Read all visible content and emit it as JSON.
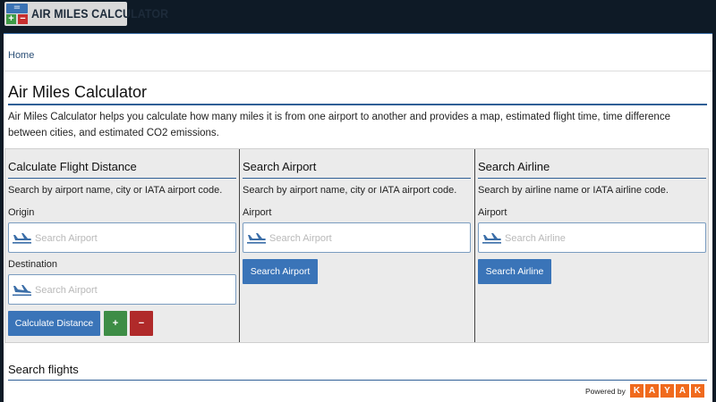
{
  "brand": {
    "logo_text": "AIR MILES CALCULATOR",
    "logo_top_glyph": "=",
    "logo_plus": "+",
    "logo_minus": "−"
  },
  "breadcrumb": {
    "home": "Home"
  },
  "page": {
    "title": "Air Miles Calculator",
    "intro": "Air Miles Calculator helps you calculate how many miles it is from one airport to another and provides a map, estimated flight time, time difference between cities, and estimated CO2 emissions."
  },
  "panels": {
    "distance": {
      "heading": "Calculate Flight Distance",
      "description": "Search by airport name, city or IATA airport code.",
      "origin_label": "Origin",
      "origin_placeholder": "Search Airport",
      "destination_label": "Destination",
      "destination_placeholder": "Search Airport",
      "calculate_button": "Calculate Distance",
      "add_button": "+",
      "remove_button": "−"
    },
    "airport": {
      "heading": "Search Airport",
      "description": "Search by airport name, city or IATA airport code.",
      "field_label": "Airport",
      "placeholder": "Search Airport",
      "button": "Search Airport"
    },
    "airline": {
      "heading": "Search Airline",
      "description": "Search by airline name or IATA airline code.",
      "field_label": "Airport",
      "placeholder": "Search Airline",
      "button": "Search Airline"
    }
  },
  "flights": {
    "heading": "Search flights",
    "powered_by": "Powered by",
    "kayak_letters": [
      "K",
      "A",
      "Y",
      "A",
      "K"
    ]
  },
  "colors": {
    "header_bg": "#0e1a26",
    "primary_blue": "#3a74b8",
    "add_green": "#3e8d46",
    "remove_red": "#b02a2a",
    "kayak_orange": "#f06a1d"
  },
  "icons": {
    "field_icon": "airplane-icon"
  }
}
